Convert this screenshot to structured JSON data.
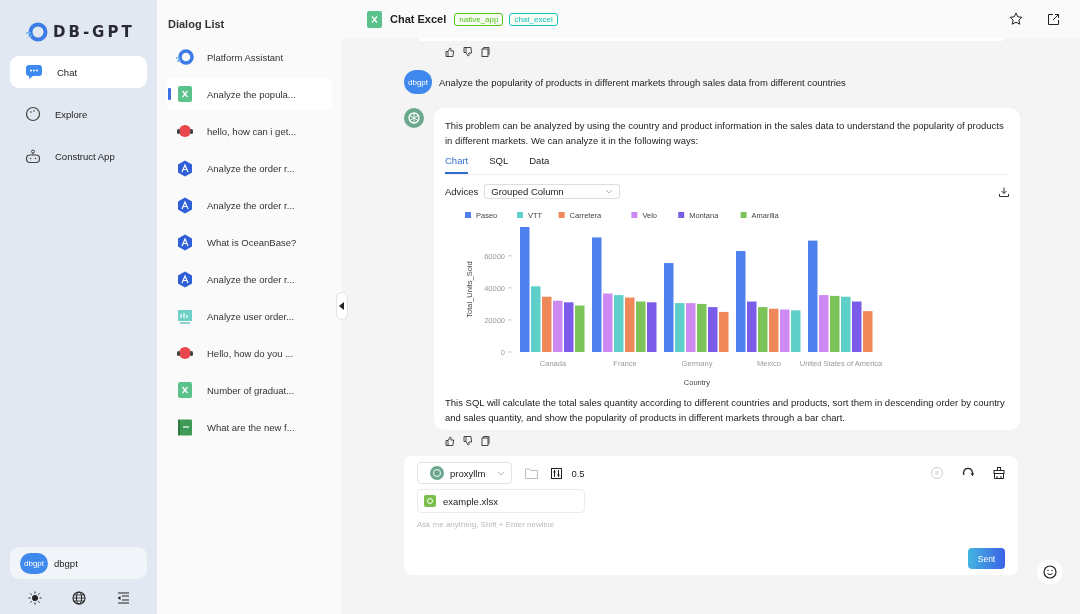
{
  "sidebar": {
    "logo": "DB-GPT",
    "nav": [
      {
        "label": "Chat",
        "kind": "chat",
        "selected": true
      },
      {
        "label": "Explore",
        "kind": "explore",
        "selected": false
      },
      {
        "label": "Construct App",
        "kind": "robot",
        "selected": false
      }
    ],
    "user": {
      "avatar": "dbgpt",
      "name": "dbgpt"
    }
  },
  "dialog_list": {
    "title": "Dialog List",
    "items": [
      {
        "title": "Platform Assistant",
        "kind": "assistant",
        "selected": false
      },
      {
        "title": "Analyze the popula...",
        "kind": "excel",
        "selected": true
      },
      {
        "title": "hello, how can i get...",
        "kind": "bot",
        "selected": false
      },
      {
        "title": "Analyze the order r...",
        "kind": "app",
        "selected": false
      },
      {
        "title": "Analyze the order r...",
        "kind": "app",
        "selected": false
      },
      {
        "title": "What is OceanBase?",
        "kind": "app",
        "selected": false
      },
      {
        "title": "Analyze the order r...",
        "kind": "app",
        "selected": false
      },
      {
        "title": "Analyze user order...",
        "kind": "report",
        "selected": false
      },
      {
        "title": "Hello, how do you ...",
        "kind": "bot",
        "selected": false
      },
      {
        "title": "Number of graduat...",
        "kind": "excel",
        "selected": false
      },
      {
        "title": "What are the new f...",
        "kind": "sheet",
        "selected": false
      }
    ]
  },
  "header": {
    "title": "Chat Excel",
    "tags": [
      {
        "label": "native_app",
        "color": "#52c41a"
      },
      {
        "label": "chat_excel",
        "color": "#13c2c2"
      }
    ]
  },
  "user_message": {
    "avatar": "dbgpt",
    "text": "Analyze the popularity of products in different markets through sales data from different countries"
  },
  "answer": {
    "intro": "This problem can be analyzed by using the country and product information in the sales data to understand the popularity of products in different markets. We can analyze it in the following ways:",
    "tabs": [
      {
        "label": "Chart",
        "selected": true
      },
      {
        "label": "SQL",
        "selected": false
      },
      {
        "label": "Data",
        "selected": false
      }
    ],
    "advices_label": "Advices",
    "advice": "Grouped Column",
    "chart_data": {
      "type": "bar",
      "xlabel": "Country",
      "ylabel": "Total_Units_Sold",
      "categories": [
        "Canada",
        "France",
        "Germany",
        "Mexico",
        "United States of America"
      ],
      "legend": "top",
      "ylim": [
        0,
        78000
      ],
      "yticks": [
        0,
        20000,
        40000,
        60000
      ],
      "series": [
        {
          "name": "Paseo",
          "color": "#4e80ee",
          "values": [
            78000,
            71500,
            55500,
            63000,
            69500
          ]
        },
        {
          "name": "VTT",
          "color": "#5ecfc9",
          "values": [
            41000,
            35500,
            30500,
            26000,
            34500
          ]
        },
        {
          "name": "Carretera",
          "color": "#f0895a",
          "values": [
            34500,
            34000,
            25000,
            27000,
            25500
          ]
        },
        {
          "name": "Velo",
          "color": "#cc8af2",
          "values": [
            32000,
            36500,
            30500,
            26500,
            35500
          ]
        },
        {
          "name": "Montana",
          "color": "#7a5ce8",
          "values": [
            31000,
            31000,
            28000,
            31500,
            31500
          ]
        },
        {
          "name": "Amarilla",
          "color": "#7cc35a",
          "values": [
            29000,
            31500,
            30000,
            28000,
            35000
          ]
        }
      ]
    },
    "summary": "This SQL will calculate the total sales quantity according to different countries and products, sort them in descending order by country and sales quantity, and show the popularity of products in different markets through a bar chart."
  },
  "input": {
    "model": "proxyllm",
    "temperature": "0.5",
    "file": "example.xlsx",
    "placeholder": "Ask me anything, Shift + Enter newline",
    "send": "Sent"
  }
}
